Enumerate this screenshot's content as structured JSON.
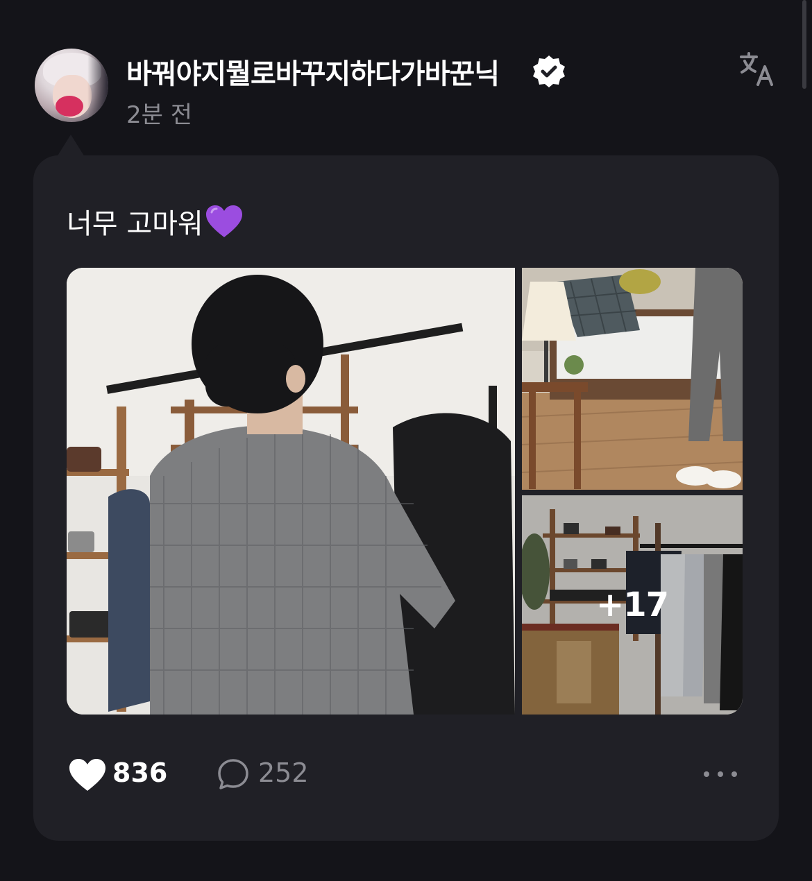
{
  "post": {
    "author_name": "바꿔야지뭘로바꾸지하다가바꾼닉",
    "verified": true,
    "time_ago": "2분 전",
    "text": "너무 고마워",
    "text_emoji": "purple-heart",
    "images_more_label": "+17",
    "likes": "836",
    "comments": "252"
  },
  "icons": {
    "translate": "translate-icon",
    "verified": "verified-badge-icon",
    "like": "heart-icon",
    "comment": "comment-bubble-icon",
    "more": "more-horizontal-icon"
  },
  "colors": {
    "background": "#141419",
    "card": "#202026",
    "muted_text": "#8c8c93",
    "accent_emoji": "#9b4de0"
  }
}
